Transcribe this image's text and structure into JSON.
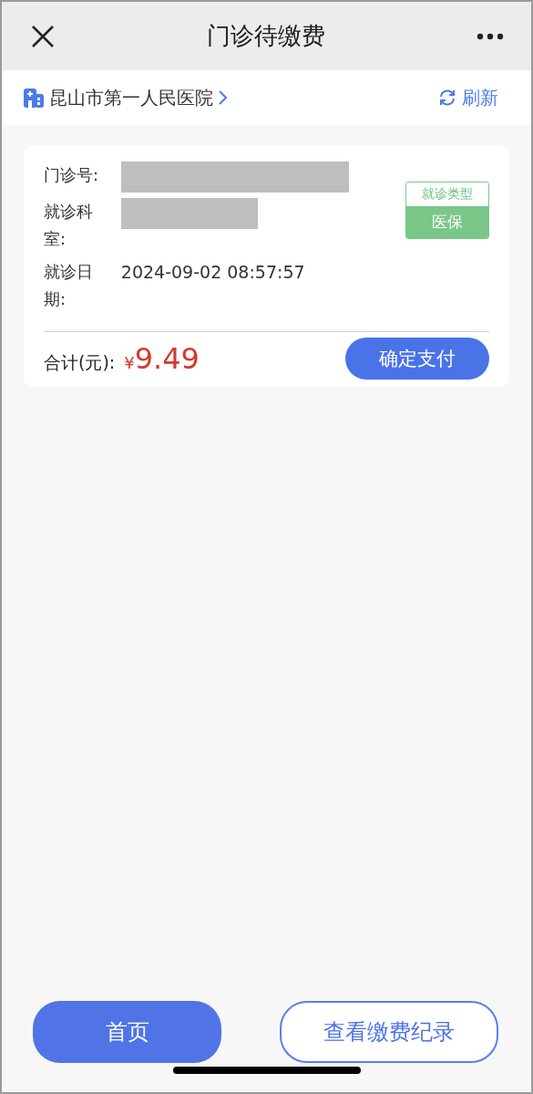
{
  "header": {
    "title": "门诊待缴费"
  },
  "hospital": {
    "name": "昆山市第一人民医院",
    "refresh": "刷新"
  },
  "card": {
    "fields": [
      {
        "label": "门诊号:",
        "kind": "redacted"
      },
      {
        "label": "就诊科室:",
        "kind": "redacted"
      },
      {
        "label": "就诊日期:",
        "kind": "text",
        "value": "2024-09-02 08:57:57"
      }
    ],
    "visit_type": {
      "label": "就诊类型",
      "value": "医保"
    },
    "total_label": "合计(元):",
    "currency": "¥",
    "amount": "9.49",
    "pay_button": "确定支付"
  },
  "buttons": [
    {
      "label": "首页",
      "kind": "primary"
    },
    {
      "label": "查看缴费纪录",
      "kind": "outline"
    }
  ]
}
